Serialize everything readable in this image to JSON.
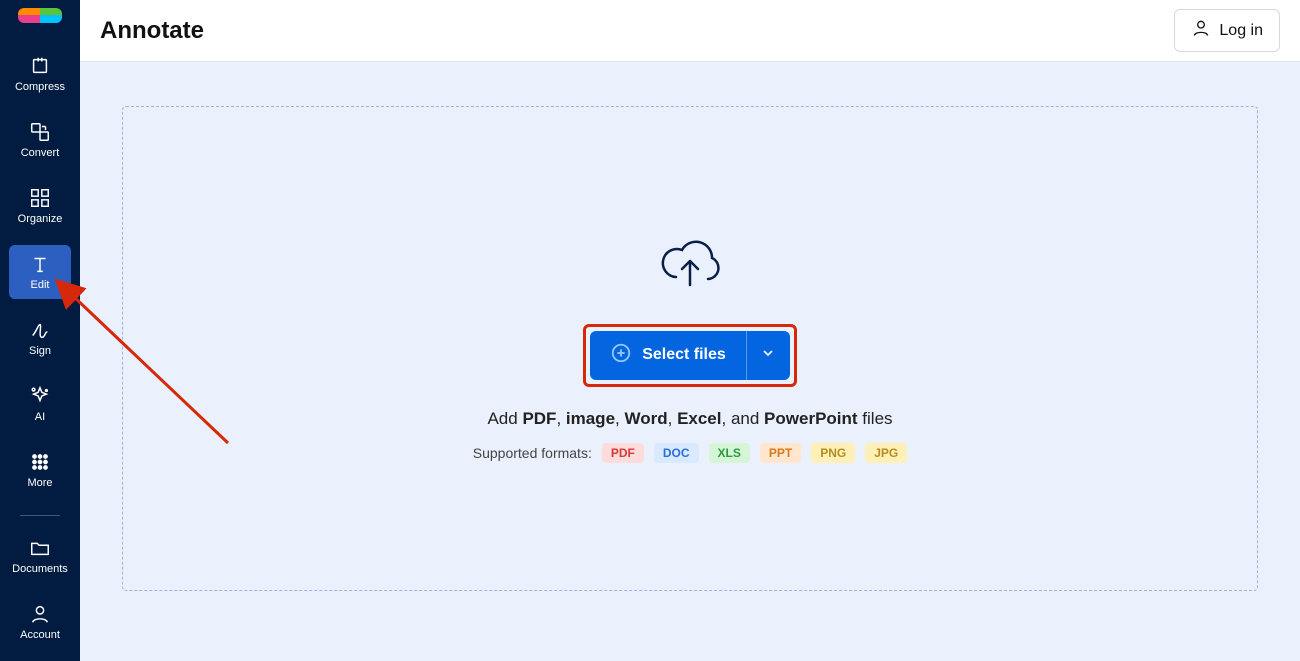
{
  "header": {
    "title": "Annotate",
    "login": "Log in"
  },
  "sidebar": {
    "items": [
      {
        "label": "Compress"
      },
      {
        "label": "Convert"
      },
      {
        "label": "Organize"
      },
      {
        "label": "Edit",
        "active": true
      },
      {
        "label": "Sign"
      },
      {
        "label": "AI"
      },
      {
        "label": "More"
      }
    ],
    "bottom": [
      {
        "label": "Documents"
      },
      {
        "label": "Account"
      }
    ]
  },
  "dropzone": {
    "select": "Select files",
    "hint_prefix": "Add ",
    "hint_bold": [
      "PDF",
      "image",
      "Word",
      "Excel",
      "PowerPoint"
    ],
    "hint_suffix": " files",
    "supported": "Supported formats:",
    "formats": [
      "PDF",
      "DOC",
      "XLS",
      "PPT",
      "PNG",
      "JPG"
    ]
  },
  "annotation": {
    "highlight_color": "#d6280b"
  }
}
